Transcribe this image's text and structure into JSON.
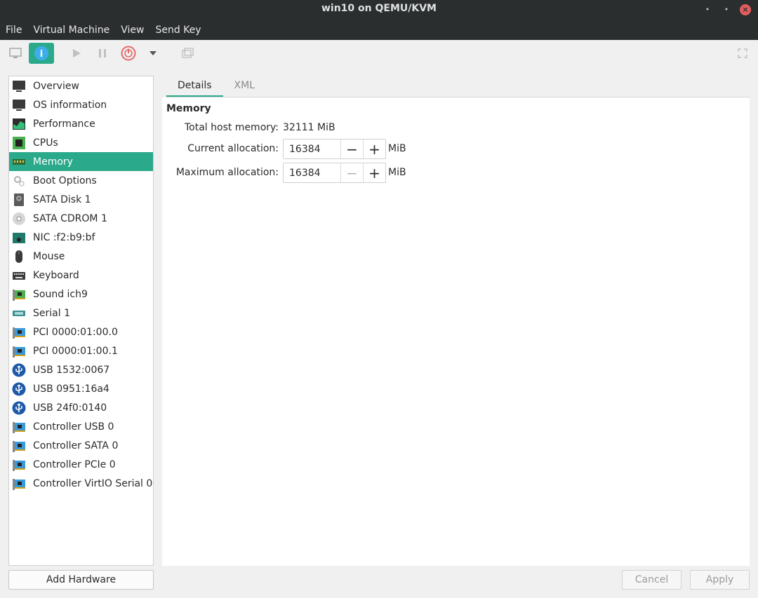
{
  "window": {
    "title": "win10 on QEMU/KVM",
    "minimize_glyph": "•",
    "maximize_glyph": "•",
    "close_glyph": "×"
  },
  "menu": [
    "File",
    "Virtual Machine",
    "View",
    "Send Key"
  ],
  "toolbar": {
    "icons": [
      "console-icon",
      "details-info-icon",
      "run-icon",
      "pause-icon",
      "shutdown-icon",
      "shutdown-menu-arrow-icon",
      "snapshots-icon",
      "fullscreen-icon"
    ],
    "details_glyph": "i",
    "accent": "#2aa98b"
  },
  "sidebar": {
    "items": [
      {
        "label": "Overview",
        "icon": "monitor-icon"
      },
      {
        "label": "OS information",
        "icon": "monitor-icon"
      },
      {
        "label": "Performance",
        "icon": "performance-graph-icon"
      },
      {
        "label": "CPUs",
        "icon": "cpu-chip-icon"
      },
      {
        "label": "Memory",
        "icon": "memory-stick-icon",
        "selected": true
      },
      {
        "label": "Boot Options",
        "icon": "gear-icon"
      },
      {
        "label": "SATA Disk 1",
        "icon": "hard-disk-icon"
      },
      {
        "label": "SATA CDROM 1",
        "icon": "cdrom-icon"
      },
      {
        "label": "NIC :f2:b9:bf",
        "icon": "network-card-icon"
      },
      {
        "label": "Mouse",
        "icon": "mouse-icon"
      },
      {
        "label": "Keyboard",
        "icon": "keyboard-icon"
      },
      {
        "label": "Sound ich9",
        "icon": "expansion-card-icon"
      },
      {
        "label": "Serial 1",
        "icon": "serial-port-icon"
      },
      {
        "label": "PCI 0000:01:00.0",
        "icon": "pci-card-icon"
      },
      {
        "label": "PCI 0000:01:00.1",
        "icon": "pci-card-icon"
      },
      {
        "label": "USB 1532:0067",
        "icon": "usb-icon"
      },
      {
        "label": "USB 0951:16a4",
        "icon": "usb-icon"
      },
      {
        "label": "USB 24f0:0140",
        "icon": "usb-icon"
      },
      {
        "label": "Controller USB 0",
        "icon": "pci-card-icon"
      },
      {
        "label": "Controller SATA 0",
        "icon": "pci-card-icon"
      },
      {
        "label": "Controller PCIe 0",
        "icon": "pci-card-icon"
      },
      {
        "label": "Controller VirtIO Serial 0",
        "icon": "pci-card-icon"
      }
    ],
    "add_hardware_label": "Add Hardware"
  },
  "tabs": [
    {
      "label": "Details",
      "active": true
    },
    {
      "label": "XML",
      "active": false
    }
  ],
  "memory": {
    "section_title": "Memory",
    "total_label": "Total host memory:",
    "total_value": "32111 MiB",
    "current_label": "Current allocation:",
    "current_value": "16384",
    "max_label": "Maximum allocation:",
    "max_value": "16384",
    "unit": "MiB",
    "minus_glyph": "−",
    "plus_glyph": "+"
  },
  "actions": {
    "cancel_label": "Cancel",
    "apply_label": "Apply"
  }
}
